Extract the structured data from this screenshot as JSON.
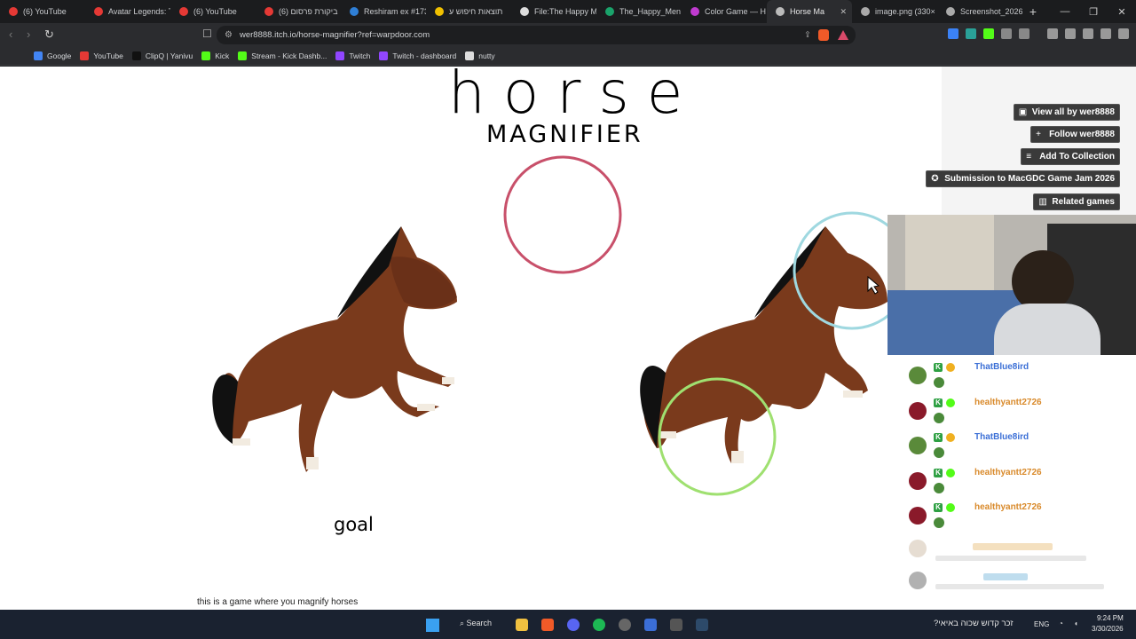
{
  "browser": {
    "tabs": [
      {
        "label": "(6) YouTube",
        "icon": "youtube-icon",
        "color": "#e53935"
      },
      {
        "label": "Avatar Legends: T",
        "icon": "youtube-icon",
        "color": "#e53935"
      },
      {
        "label": "(6) YouTube",
        "icon": "youtube-icon",
        "color": "#e53935"
      },
      {
        "label": "ביקורת פרסום (6)",
        "icon": "youtube-icon",
        "color": "#e53935"
      },
      {
        "label": "Reshiram ex #173",
        "icon": "cards-icon",
        "color": "#2f7fd6"
      },
      {
        "label": "תוצאות חיפוש ע",
        "icon": "k-icon",
        "color": "#f0c000"
      },
      {
        "label": "File:The Happy M",
        "icon": "wiki-icon",
        "color": "#dddddd"
      },
      {
        "label": "The_Happy_Men",
        "icon": "m-icon",
        "color": "#1aa36b"
      },
      {
        "label": "Color Game — H",
        "icon": "color-icon",
        "color": "#c03bd0"
      },
      {
        "label": "Horse Ma",
        "icon": "audio-icon",
        "color": "#bbbbbb",
        "active": true
      },
      {
        "label": "image.png (330×",
        "icon": "globe-icon",
        "color": "#aaaaaa"
      },
      {
        "label": "Screenshot_2026",
        "icon": "globe-icon",
        "color": "#aaaaaa"
      }
    ],
    "new_tab": "+",
    "url": "wer8888.itch.io/horse-magnifier?ref=warpdoor.com",
    "bookmarks": [
      {
        "label": "Google",
        "color": "#4285f4"
      },
      {
        "label": "YouTube",
        "color": "#e53935"
      },
      {
        "label": "ClipQ | Yanivu",
        "color": "#111111"
      },
      {
        "label": "Kick",
        "color": "#53fc18"
      },
      {
        "label": "Stream - Kick Dashb...",
        "color": "#53fc18"
      },
      {
        "label": "Twitch",
        "color": "#9146ff"
      },
      {
        "label": "Twitch - dashboard",
        "color": "#9146ff"
      },
      {
        "label": "nutty",
        "color": "#dddddd"
      }
    ]
  },
  "game": {
    "title_big": "horse",
    "title_small": "MAGNIFIER",
    "goal_label": "goal",
    "description": "this is a game where you magnify horses"
  },
  "itch_buttons": [
    {
      "label": "View all by wer8888",
      "icon": "▣"
    },
    {
      "label": "Follow wer8888",
      "icon": "+"
    },
    {
      "label": "Add To Collection",
      "icon": "≡"
    },
    {
      "label": "Submission to MacGDC Game Jam 2026",
      "icon": "✪"
    },
    {
      "label": "Related games",
      "icon": "▥"
    }
  ],
  "chat": [
    {
      "name": "ThatBlue8ird",
      "color": "#3b6fd6"
    },
    {
      "name": "healthyantt2726",
      "color": "#d98a2b"
    },
    {
      "name": "ThatBlue8ird",
      "color": "#3b6fd6"
    },
    {
      "name": "healthyantt2726",
      "color": "#d98a2b"
    },
    {
      "name": "healthyantt2726",
      "color": "#d98a2b"
    }
  ],
  "taskbar": {
    "search_label": "Search",
    "lang": "ENG",
    "time": "9:24 PM",
    "date": "3/30/2026",
    "notification": "?זכר קדוש שכוה באיאי"
  }
}
